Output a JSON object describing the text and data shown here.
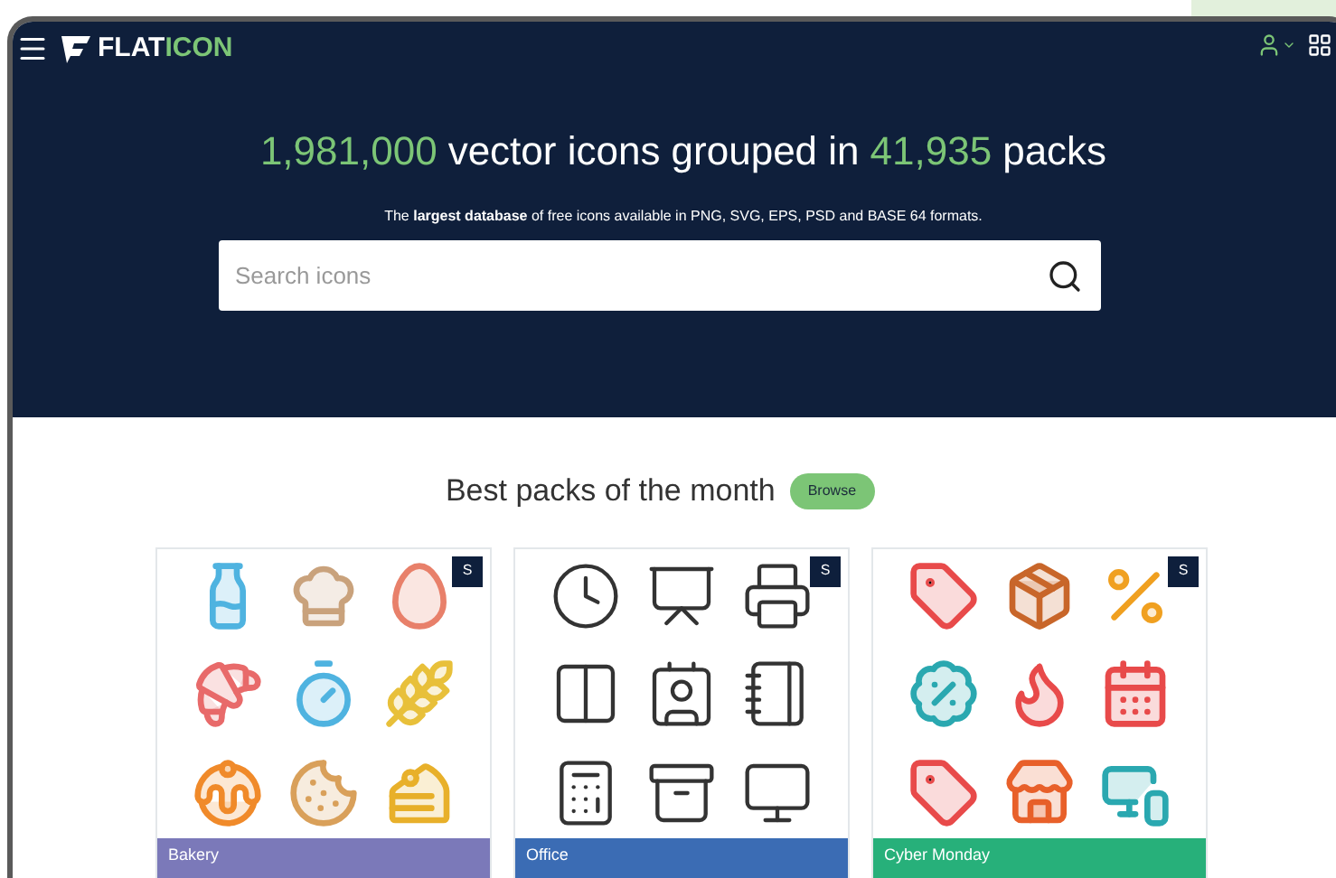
{
  "brand": {
    "part_1": "FLAT",
    "part_2": "ICON"
  },
  "hero": {
    "headline": [
      {
        "text": "1,981,000",
        "highlight": true
      },
      {
        "text": "vector icons grouped in",
        "highlight": false
      },
      {
        "text": "41,935",
        "highlight": true
      },
      {
        "text": "packs",
        "highlight": false
      }
    ],
    "subtitle": "The **largest database** of free icons available in PNG, SVG, EPS, PSD and BASE 64 formats.",
    "search": {
      "placeholder": "Search icons"
    }
  },
  "section": {
    "title": "Best packs of the month",
    "button": "Browse"
  },
  "packs": [
    {
      "name": "Bakery",
      "kind": "bakery",
      "color": "#7b79b9",
      "premium_mark": "S"
    },
    {
      "name": "Office",
      "kind": "office",
      "color": "#3b6cb4",
      "premium_mark": "S"
    },
    {
      "name": "Cyber Monday",
      "kind": "sale",
      "color": "#27b07a",
      "premium_mark": "S"
    }
  ]
}
